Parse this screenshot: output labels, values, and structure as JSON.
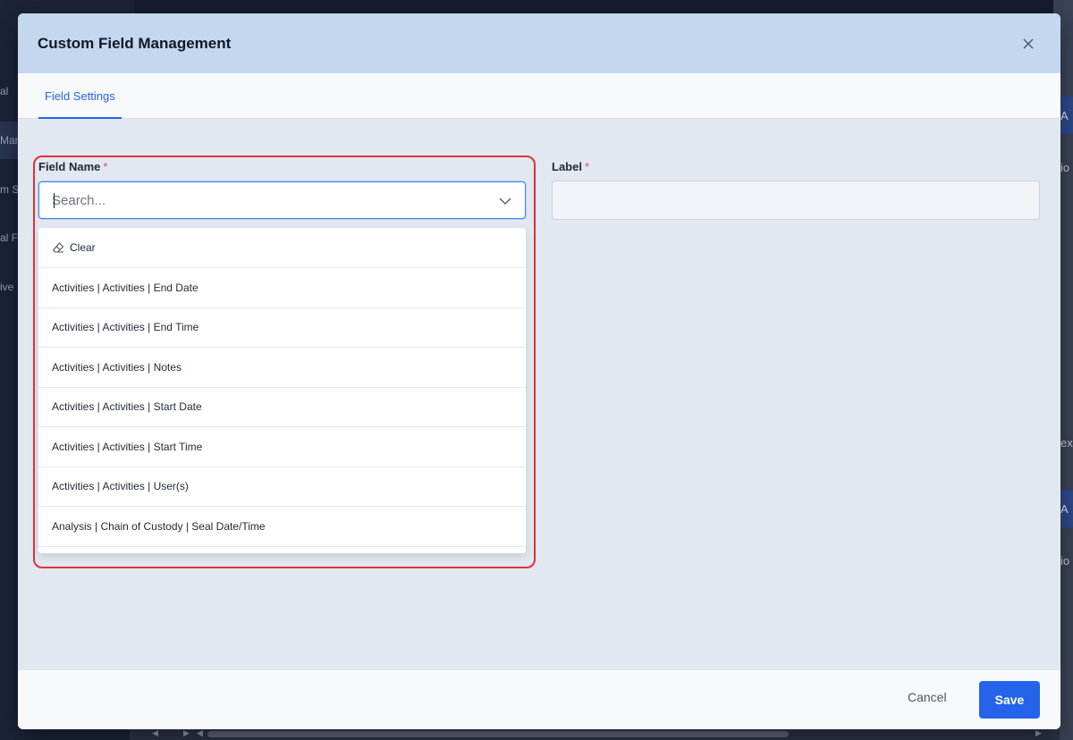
{
  "background": {
    "nav_items": [
      "al",
      "Man",
      "m S",
      "al F",
      "ive"
    ],
    "right_texts": [
      "A",
      "io",
      "ex",
      "A",
      "io"
    ]
  },
  "modal": {
    "title": "Custom Field Management",
    "close_icon": "close-icon",
    "tabs": [
      {
        "label": "Field Settings",
        "active": true
      }
    ],
    "field_name": {
      "label": "Field Name",
      "required_mark": "*",
      "placeholder": "Search...",
      "value": ""
    },
    "label_field": {
      "label": "Label",
      "required_mark": "*",
      "value": ""
    },
    "dropdown": {
      "clear_label": "Clear",
      "options": [
        "Activities | Activities | End Date",
        "Activities | Activities | End Time",
        "Activities | Activities | Notes",
        "Activities | Activities | Start Date",
        "Activities | Activities | Start Time",
        "Activities | Activities | User(s)",
        "Analysis | Chain of Custody | Seal Date/Time"
      ]
    },
    "footer": {
      "cancel_label": "Cancel",
      "save_label": "Save"
    }
  },
  "colors": {
    "accent": "#2563eb",
    "highlight": "#e0303c",
    "header": "#c5d7ef"
  }
}
